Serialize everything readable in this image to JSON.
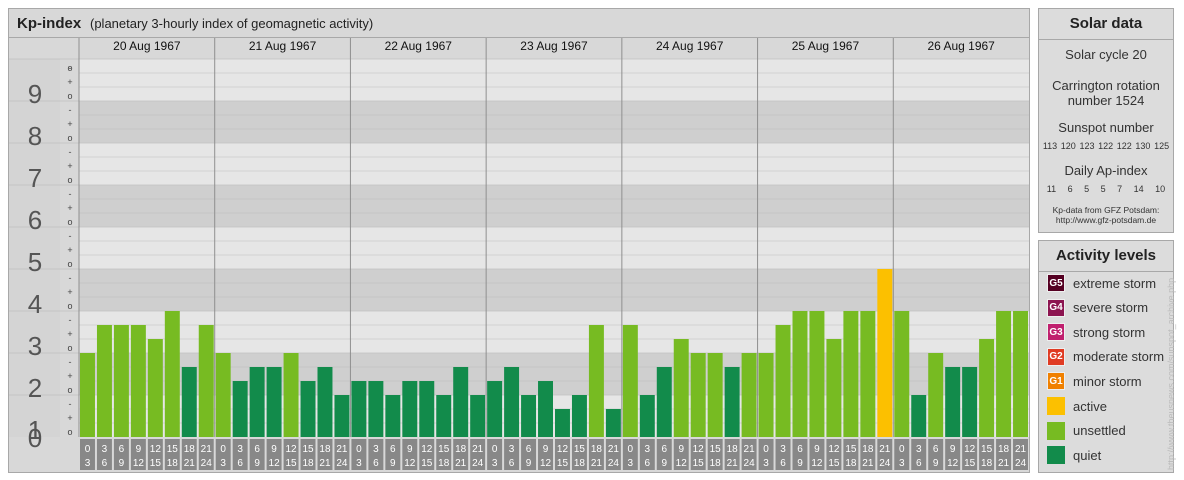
{
  "title": {
    "main": "Kp-index",
    "sub": "(planetary 3-hourly index of geomagnetic activity)"
  },
  "chart_data": {
    "type": "bar",
    "y_range": [
      0,
      9
    ],
    "y_tick_labels": [
      "0",
      "1",
      "2",
      "3",
      "4",
      "5",
      "6",
      "7",
      "8",
      "9"
    ],
    "minor_tick_labels": [
      "o",
      "+",
      "-"
    ],
    "days": [
      "20 Aug 1967",
      "21 Aug 1967",
      "22 Aug 1967",
      "23 Aug 1967",
      "24 Aug 1967",
      "25 Aug 1967",
      "26 Aug 1967"
    ],
    "hour_start": [
      "0",
      "3",
      "6",
      "9",
      "12",
      "15",
      "18",
      "21"
    ],
    "hour_end": [
      "3",
      "6",
      "9",
      "12",
      "15",
      "18",
      "21",
      "24"
    ],
    "values": [
      [
        2.0,
        2.667,
        2.667,
        2.667,
        2.333,
        3.0,
        1.667,
        2.667
      ],
      [
        2.0,
        1.333,
        1.667,
        1.667,
        2.0,
        1.333,
        1.667,
        1.0
      ],
      [
        1.333,
        1.333,
        1.0,
        1.333,
        1.333,
        1.0,
        1.667,
        1.0
      ],
      [
        1.333,
        1.667,
        1.0,
        1.333,
        0.667,
        1.0,
        2.667,
        0.667
      ],
      [
        2.667,
        1.0,
        1.667,
        2.333,
        2.0,
        2.0,
        1.667,
        2.0
      ],
      [
        2.0,
        2.667,
        3.0,
        3.0,
        2.333,
        3.0,
        3.0,
        4.0
      ],
      [
        3.0,
        1.0,
        2.0,
        1.667,
        1.667,
        2.333,
        3.0,
        3.0
      ]
    ],
    "level_colors": {
      "quiet": "#128b4b",
      "unsettled": "#77bb22",
      "active": "#fcc000"
    }
  },
  "solar": {
    "title": "Solar data",
    "cycle": "Solar cycle 20",
    "carrington_1": "Carrington rotation",
    "carrington_2": "number 1524",
    "sunspot_title": "Sunspot number",
    "sunspot": [
      "113",
      "120",
      "123",
      "122",
      "122",
      "130",
      "125"
    ],
    "ap_title": "Daily Ap-index",
    "ap": [
      "11",
      "6",
      "5",
      "5",
      "7",
      "14",
      "10"
    ],
    "credit_1": "Kp-data from GFZ Potsdam:",
    "credit_2": "http://www.gfz-potsdam.de"
  },
  "levels": {
    "title": "Activity levels",
    "items": [
      {
        "code": "G5",
        "label": "extreme storm",
        "color": "#550022"
      },
      {
        "code": "G4",
        "label": "severe storm",
        "color": "#8c1450"
      },
      {
        "code": "G3",
        "label": "strong storm",
        "color": "#c01f6e"
      },
      {
        "code": "G2",
        "label": "moderate storm",
        "color": "#e03b23"
      },
      {
        "code": "G1",
        "label": "minor storm",
        "color": "#f08000"
      },
      {
        "code": "",
        "label": "active",
        "color": "#fcc000"
      },
      {
        "code": "",
        "label": "unsettled",
        "color": "#77bb22"
      },
      {
        "code": "",
        "label": "quiet",
        "color": "#128b4b"
      }
    ]
  },
  "side_url": "http://www.theusnews.com/sunspot_archive.php"
}
